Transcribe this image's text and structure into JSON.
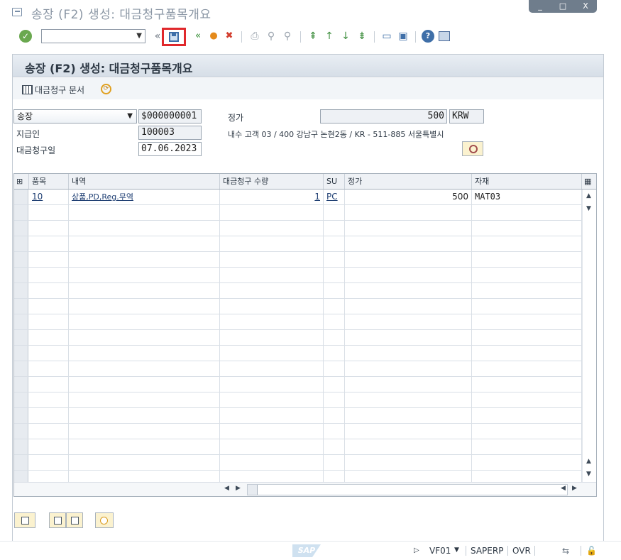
{
  "window": {
    "title": "송장 (F2) 생성: 대금청구품목개요",
    "controls": [
      "_",
      "□",
      "X"
    ]
  },
  "toolbar": {
    "command_value": "",
    "icons": [
      "enter-icon",
      "save-icon",
      "back-icon",
      "exit-icon",
      "cancel-icon",
      "print-icon",
      "find-icon",
      "find-next-icon",
      "first-page-icon",
      "previous-page-icon",
      "next-page-icon",
      "last-page-icon",
      "new-session-icon",
      "shortcut-icon",
      "help-icon",
      "customize-layout-icon"
    ]
  },
  "panel": {
    "title": "송장 (F2) 생성: 대금청구품목개요",
    "billing_doc_label": "대금청구 문서"
  },
  "form": {
    "doc_type": "송장",
    "doc_number": "$000000001",
    "payer_label": "지급인",
    "payer_value": "100003",
    "billing_date_label": "대금청구일",
    "billing_date_value": "07.06.2023",
    "net_value_label": "정가",
    "net_value": "500",
    "currency": "KRW",
    "address": "내수 고객 03 / 400 강남구 논현2동 / KR - 511-885 서울특별시"
  },
  "table": {
    "columns": [
      "품목",
      "내역",
      "대금청구 수량",
      "SU",
      "정가",
      "자재"
    ],
    "rows": [
      {
        "item": "10",
        "description": "상품,PD,Reg.무역",
        "qty": "1",
        "su": "PC",
        "net": "500",
        "material": "MAT03"
      }
    ],
    "empty_rows": 18
  },
  "status": {
    "logo": "SAP",
    "transaction": "VF01",
    "system": "SAPERP",
    "mode": "OVR"
  }
}
